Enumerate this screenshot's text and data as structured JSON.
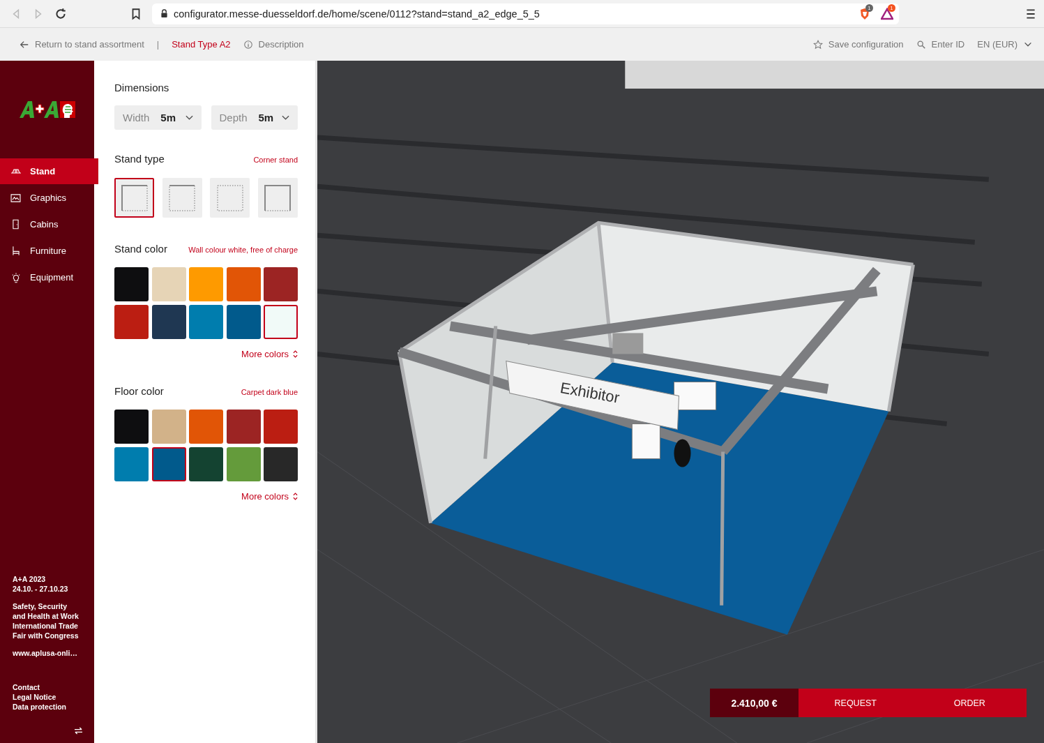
{
  "browser": {
    "url": "configurator.messe-duesseldorf.de/home/scene/0112?stand=stand_a2_edge_5_5",
    "shield_badge": "1",
    "rewards_badge": "1"
  },
  "topbar": {
    "back": "Return to stand assortment",
    "separator": "|",
    "stand_type": "Stand Type A2",
    "description": "Description",
    "save": "Save configuration",
    "enter_id": "Enter ID",
    "language": "EN (EUR)"
  },
  "sidebar": {
    "items": [
      {
        "label": "Stand",
        "kind": "stand",
        "selected": true
      },
      {
        "label": "Graphics",
        "kind": "graphics",
        "selected": false
      },
      {
        "label": "Cabins",
        "kind": "cabins",
        "selected": false
      },
      {
        "label": "Furniture",
        "kind": "furniture",
        "selected": false
      },
      {
        "label": "Equipment",
        "kind": "equipment",
        "selected": false
      }
    ],
    "event": [
      "A+A 2023",
      "24.10. - 27.10.23"
    ],
    "about": [
      "Safety, Security",
      "and Health at Work",
      "International Trade",
      "Fair with Congress"
    ],
    "website": "www.aplusa-onli…",
    "links": [
      "Contact",
      "Legal Notice",
      "Data protection"
    ]
  },
  "panel": {
    "dimensions": {
      "title": "Dimensions",
      "width_label": "Width",
      "width_value": "5m",
      "depth_label": "Depth",
      "depth_value": "5m"
    },
    "stand_type": {
      "title": "Stand type",
      "note": "Corner stand",
      "options": [
        {
          "kind": "corner",
          "selected": true
        },
        {
          "kind": "row",
          "selected": false
        },
        {
          "kind": "island",
          "selected": false
        },
        {
          "kind": "head",
          "selected": false
        }
      ]
    },
    "stand_color": {
      "title": "Stand color",
      "note": "Wall colour white, free of charge",
      "more": "More colors",
      "swatches": [
        {
          "color": "#0e0e10",
          "selected": false
        },
        {
          "color": "#e6d4b6",
          "selected": false
        },
        {
          "color": "#fe9a00",
          "selected": false
        },
        {
          "color": "#e15506",
          "selected": false
        },
        {
          "color": "#9c2423",
          "selected": false
        },
        {
          "color": "#bb1e12",
          "selected": false
        },
        {
          "color": "#1f3752",
          "selected": false
        },
        {
          "color": "#007dae",
          "selected": false
        },
        {
          "color": "#015a8c",
          "selected": false
        },
        {
          "color": "#f1faf8",
          "selected": true
        }
      ]
    },
    "floor_color": {
      "title": "Floor color",
      "note": "Carpet dark blue",
      "more": "More colors",
      "swatches": [
        {
          "color": "#0e0e10",
          "selected": false
        },
        {
          "color": "#d2b289",
          "selected": false
        },
        {
          "color": "#e15506",
          "selected": false
        },
        {
          "color": "#9c2423",
          "selected": false
        },
        {
          "color": "#bb1e12",
          "selected": false
        },
        {
          "color": "#007dae",
          "selected": false
        },
        {
          "color": "#015a8c",
          "selected": true
        },
        {
          "color": "#144331",
          "selected": false
        },
        {
          "color": "#649b3b",
          "selected": false
        },
        {
          "color": "#282828",
          "selected": false
        }
      ]
    }
  },
  "scene": {
    "sign": "Exhibitor"
  },
  "order_bar": {
    "price": "2.410,00 €",
    "request": "REQUEST",
    "order": "ORDER"
  }
}
